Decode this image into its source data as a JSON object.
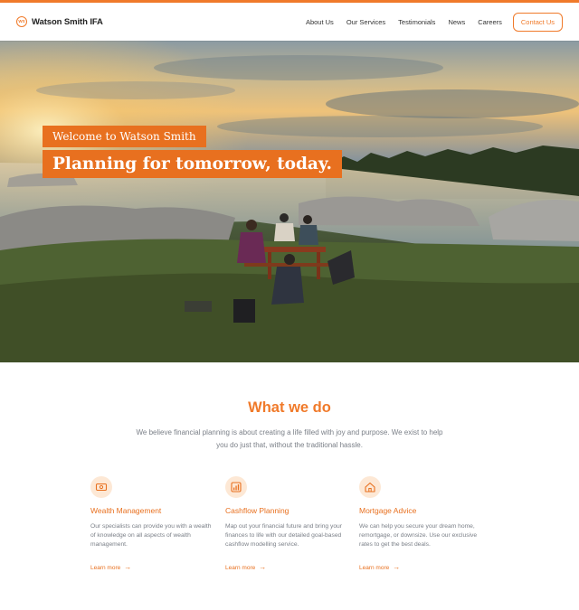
{
  "brand": {
    "name": "Watson Smith IFA",
    "logo_initials": "WS",
    "accent": "#f07a2a"
  },
  "nav": {
    "links": [
      "About Us",
      "Our Services",
      "Testimonials",
      "News",
      "Careers"
    ],
    "contact_label": "Contact Us"
  },
  "hero": {
    "tagline": "Welcome to Watson Smith",
    "headline": "Planning for tomorrow, today."
  },
  "what_we_do": {
    "title": "What we do",
    "description": "We believe financial planning is about creating a life filled with joy and purpose. We exist to help you do just that, without the traditional hassle.",
    "cards": [
      {
        "icon": "money-icon",
        "title": "Wealth Management",
        "description": "Our specialists can provide you with a wealth of knowledge on all aspects of wealth management.",
        "link": "Learn more"
      },
      {
        "icon": "bar-chart-icon",
        "title": "Cashflow Planning",
        "description": "Map out your financial future and bring your finances to life with our detailed goal-based cashflow modelling service.",
        "link": "Learn more"
      },
      {
        "icon": "home-icon",
        "title": "Mortgage Advice",
        "description": "We can help you secure your dream home, remortgage, or downsize. Use our exclusive rates to get the best deals.",
        "link": "Learn more"
      }
    ]
  }
}
